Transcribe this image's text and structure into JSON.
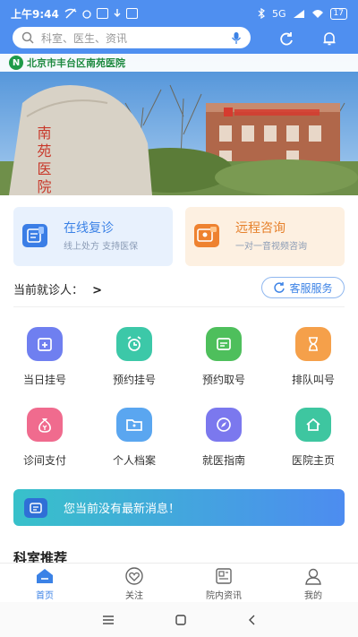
{
  "status_bar": {
    "time": "上午9:44",
    "network": "5G",
    "battery": "17"
  },
  "search": {
    "placeholder": "科室、医生、资讯"
  },
  "banner": {
    "hospital_name": "北京市丰台区南苑医院",
    "logo_letter": "N",
    "stone_text": "南苑医院"
  },
  "cards": [
    {
      "title": "在线复诊",
      "subtitle": "线上处方 支持医保",
      "title_color": "#3b82e6",
      "bg": "#e8f1fd"
    },
    {
      "title": "远程咨询",
      "subtitle": "一对一音视频咨询",
      "title_color": "#e6812c",
      "bg": "#fdf0e1"
    }
  ],
  "patient": {
    "label": "当前就诊人：",
    "chevron": ">",
    "service_button": "客服服务"
  },
  "grid": [
    {
      "label": "当日挂号",
      "icon": "calendar-plus-icon",
      "color": "#6f7ff0"
    },
    {
      "label": "预约挂号",
      "icon": "alarm-clock-icon",
      "color": "#3cc8a8"
    },
    {
      "label": "预约取号",
      "icon": "ticket-icon",
      "color": "#4ebf5c"
    },
    {
      "label": "排队叫号",
      "icon": "hourglass-icon",
      "color": "#f5a04a"
    },
    {
      "label": "诊间支付",
      "icon": "money-bag-icon",
      "color": "#f06b8e"
    },
    {
      "label": "个人档案",
      "icon": "folder-icon",
      "color": "#5aa6f0"
    },
    {
      "label": "就医指南",
      "icon": "compass-icon",
      "color": "#7b78ee"
    },
    {
      "label": "医院主页",
      "icon": "home-icon",
      "color": "#3ec6a0"
    }
  ],
  "message": {
    "text": "您当前没有最新消息！"
  },
  "section": {
    "title": "科室推荐"
  },
  "tabs": [
    {
      "label": "首页",
      "icon": "home-tab-icon",
      "active": true
    },
    {
      "label": "关注",
      "icon": "heart-icon",
      "active": false
    },
    {
      "label": "院内资讯",
      "icon": "news-icon",
      "active": false
    },
    {
      "label": "我的",
      "icon": "user-icon",
      "active": false
    }
  ],
  "colors": {
    "primary": "#4f8ff0",
    "accent_blue": "#3b82e6"
  }
}
